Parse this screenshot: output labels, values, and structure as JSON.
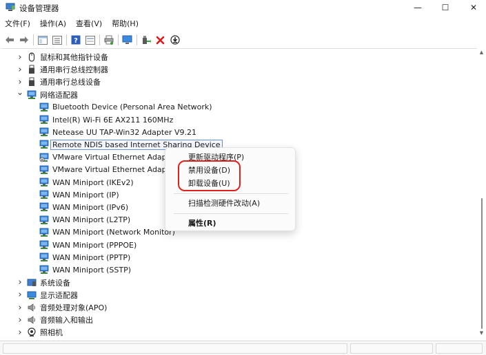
{
  "window": {
    "title": "设备管理器",
    "minimize_glyph": "—",
    "maximize_glyph": "☐",
    "close_glyph": "✕"
  },
  "menu": [
    {
      "label": "文件(F)"
    },
    {
      "label": "操作(A)"
    },
    {
      "label": "查看(V)"
    },
    {
      "label": "帮助(H)"
    }
  ],
  "toolbar": {
    "icons": [
      "back-arrow-icon",
      "forward-arrow-icon",
      "properties-window-icon",
      "list-view-icon",
      "help-icon",
      "details-icon",
      "print-icon",
      "computer-monitor-icon",
      "add-driver-icon",
      "uninstall-x-icon",
      "download-icon"
    ],
    "uninstall_color": "#d61c1c"
  },
  "tree": [
    {
      "label": "鼠标和其他指针设备",
      "level": 0,
      "expanded": false,
      "icon": "mouse-icon"
    },
    {
      "label": "通用串行总线控制器",
      "level": 0,
      "expanded": false,
      "icon": "usb-icon"
    },
    {
      "label": "通用串行总线设备",
      "level": 0,
      "expanded": false,
      "icon": "usb-icon"
    },
    {
      "label": "网络适配器",
      "level": 0,
      "expanded": true,
      "icon": "network-adapter-icon"
    },
    {
      "label": "Bluetooth Device (Personal Area Network)",
      "level": 1,
      "icon": "network-adapter-icon"
    },
    {
      "label": "Intel(R) Wi-Fi 6E AX211 160MHz",
      "level": 1,
      "icon": "network-adapter-icon"
    },
    {
      "label": "Netease UU TAP-Win32 Adapter V9.21",
      "level": 1,
      "icon": "network-adapter-icon"
    },
    {
      "label": "Remote NDIS based Internet Sharing Device",
      "level": 1,
      "icon": "network-adapter-icon",
      "selected": true
    },
    {
      "label": "VMware Virtual Ethernet Adapt",
      "level": 1,
      "icon": "network-adapter-disabled-icon"
    },
    {
      "label": "VMware Virtual Ethernet Adapt",
      "level": 1,
      "icon": "network-adapter-icon"
    },
    {
      "label": "WAN Miniport (IKEv2)",
      "level": 1,
      "icon": "network-adapter-icon"
    },
    {
      "label": "WAN Miniport (IP)",
      "level": 1,
      "icon": "network-adapter-icon"
    },
    {
      "label": "WAN Miniport (IPv6)",
      "level": 1,
      "icon": "network-adapter-icon"
    },
    {
      "label": "WAN Miniport (L2TP)",
      "level": 1,
      "icon": "network-adapter-icon"
    },
    {
      "label": "WAN Miniport (Network Monitor)",
      "level": 1,
      "icon": "network-adapter-icon"
    },
    {
      "label": "WAN Miniport (PPPOE)",
      "level": 1,
      "icon": "network-adapter-icon"
    },
    {
      "label": "WAN Miniport (PPTP)",
      "level": 1,
      "icon": "network-adapter-icon"
    },
    {
      "label": "WAN Miniport (SSTP)",
      "level": 1,
      "icon": "network-adapter-icon"
    },
    {
      "label": "系统设备",
      "level": 0,
      "expanded": false,
      "icon": "system-devices-icon"
    },
    {
      "label": "显示适配器",
      "level": 0,
      "expanded": false,
      "icon": "display-adapter-icon"
    },
    {
      "label": "音频处理对象(APO)",
      "level": 0,
      "expanded": false,
      "icon": "speaker-icon"
    },
    {
      "label": "音频输入和输出",
      "level": 0,
      "expanded": false,
      "icon": "speaker-icon"
    },
    {
      "label": "照相机",
      "level": 0,
      "expanded": false,
      "icon": "camera-icon"
    }
  ],
  "context_menu": {
    "items": [
      {
        "label": "更新驱动程序(P)",
        "bold": false
      },
      {
        "label": "禁用设备(D)",
        "bold": false
      },
      {
        "label": "卸载设备(U)",
        "bold": false
      },
      {
        "label": "扫描检测硬件改动(A)",
        "bold": false
      },
      {
        "label": "属性(R)",
        "bold": true
      }
    ]
  },
  "colors": {
    "highlight_ring": "#e0201b",
    "selection_border": "#6a8fd1",
    "network_icon_blue": "#2b7bd6"
  }
}
